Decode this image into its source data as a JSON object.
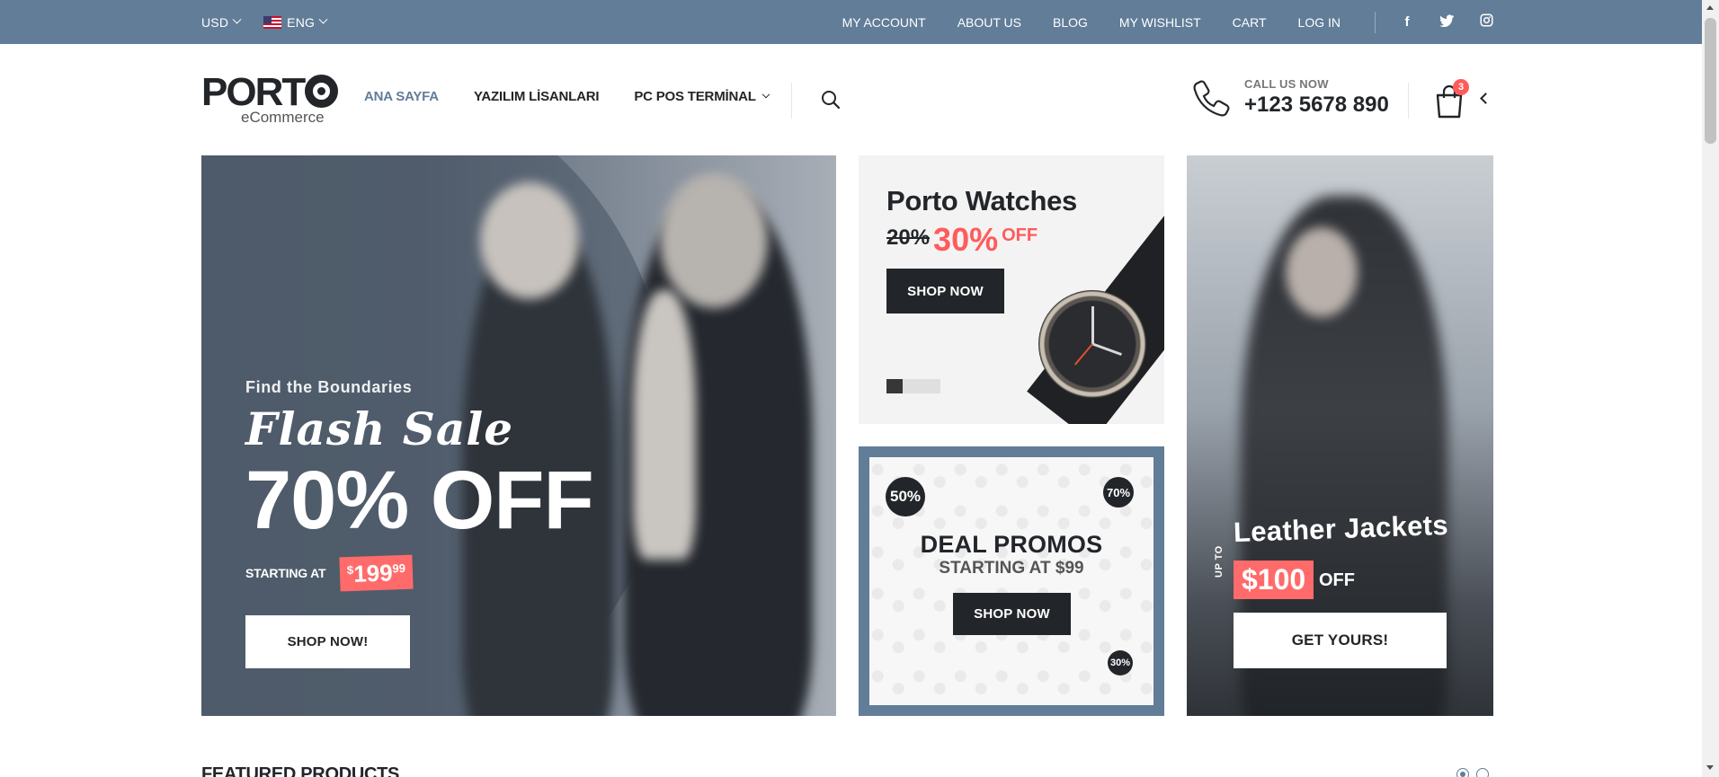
{
  "topbar": {
    "currency": "USD",
    "language": "ENG",
    "links": [
      "MY ACCOUNT",
      "ABOUT US",
      "BLOG",
      "MY WISHLIST",
      "CART",
      "LOG IN"
    ],
    "social": [
      {
        "icon": "facebook-icon",
        "glyph": "f"
      },
      {
        "icon": "twitter-icon",
        "glyph": "t"
      },
      {
        "icon": "instagram-icon",
        "glyph": "◎"
      }
    ],
    "bg_color": "#617d98"
  },
  "header": {
    "logo_word": "PORT",
    "logo_sub": "eCommerce",
    "nav": [
      {
        "label": "ANA SAYFA",
        "active": true
      },
      {
        "label": "YAZILIM LİSANLARI",
        "active": false
      },
      {
        "label": "PC POS TERMİNAL",
        "active": false,
        "dropdown": true
      }
    ],
    "call_label": "CALL US NOW",
    "phone": "+123 5678 890",
    "cart_count": "3"
  },
  "banners": {
    "flash": {
      "kicker": "Find the Boundaries",
      "script": "Flash Sale",
      "headline": "70% OFF",
      "starting": "STARTING AT",
      "price_currency": "$",
      "price_amount": "199",
      "price_cents": "99",
      "button": "SHOP NOW!"
    },
    "watches": {
      "title": "Porto Watches",
      "old_pct": "20%",
      "new_pct": "30%",
      "off": "OFF",
      "button": "SHOP NOW"
    },
    "deals": {
      "title": "DEAL PROMOS",
      "subtitle": "STARTING AT $99",
      "button": "SHOP NOW",
      "badges": [
        "50%",
        "70%",
        "30%"
      ]
    },
    "jackets": {
      "title": "Leather Jackets",
      "upto": "UP TO",
      "price": "$100",
      "off": "OFF",
      "button": "GET YOURS!"
    }
  },
  "featured": {
    "heading": "FEATURED PRODUCTS"
  },
  "colors": {
    "accent": "#617d98",
    "sale": "#ff6b6b",
    "dark": "#222529"
  }
}
